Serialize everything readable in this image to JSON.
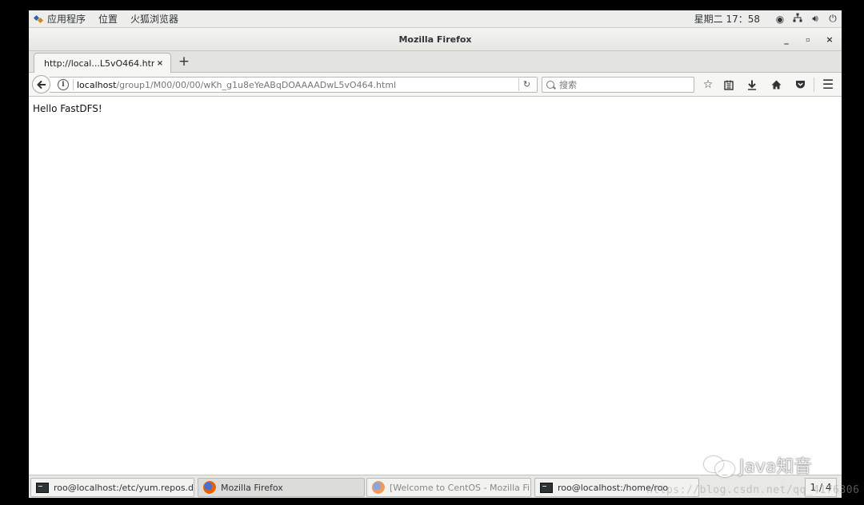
{
  "topbar": {
    "apps_menu": "应用程序",
    "places_menu": "位置",
    "active_app": "火狐浏览器",
    "clock": "星期二 17：58",
    "tray_icons": [
      "screen-record-icon",
      "network-icon",
      "volume-icon",
      "power-icon"
    ]
  },
  "window": {
    "title": "Mozilla Firefox",
    "controls": {
      "minimize": "_",
      "maximize": "▫",
      "close": "×"
    }
  },
  "tabs": {
    "active_tab_label": "http://local...L5vO464.html",
    "close_glyph": "×",
    "new_tab_glyph": "+"
  },
  "navbar": {
    "back_glyph": "🡠",
    "url_host": "localhost",
    "url_path": "/group1/M00/00/00/wKh_g1u8eYeABqDOAAAADwL5vO464.html",
    "search_placeholder": "搜索",
    "icons": [
      "bookmark-star-icon",
      "reader-view-icon",
      "download-icon",
      "home-icon",
      "pocket-icon",
      "hamburger-menu-icon"
    ]
  },
  "content": {
    "body_text": "Hello FastDFS!"
  },
  "taskbar": {
    "tasks": [
      {
        "label": "roo@localhost:/etc/yum.repos.d",
        "icon": "terminal-icon"
      },
      {
        "label": "Mozilla Firefox",
        "icon": "firefox-icon"
      },
      {
        "label": "[Welcome to CentOS - Mozilla Fire…",
        "icon": "firefox-icon"
      },
      {
        "label": "roo@localhost:/home/roo",
        "icon": "terminal-icon"
      }
    ],
    "workspace": "1 / 4"
  },
  "watermarks": {
    "brand": "Java知音",
    "url": "https://blog.csdn.net/qq_4176306"
  }
}
